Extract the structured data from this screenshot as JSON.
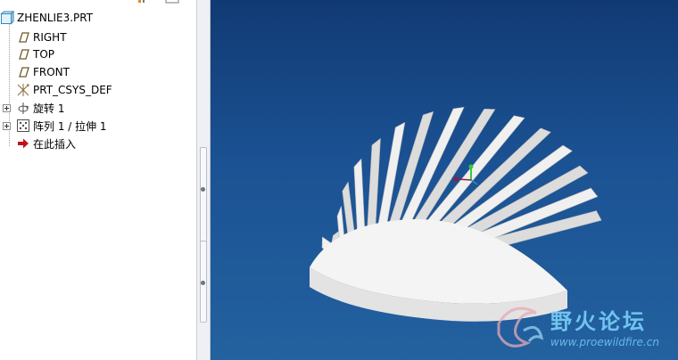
{
  "model_tree": {
    "root": "ZHENLIE3.PRT",
    "items": [
      {
        "label": "RIGHT",
        "icon": "datum-plane-icon"
      },
      {
        "label": "TOP",
        "icon": "datum-plane-icon"
      },
      {
        "label": "FRONT",
        "icon": "datum-plane-icon"
      },
      {
        "label": "PRT_CSYS_DEF",
        "icon": "coordinate-system-icon"
      },
      {
        "label": "旋转 1",
        "icon": "revolve-icon"
      },
      {
        "label": "阵列 1 / 拉伸 1",
        "icon": "pattern-icon"
      },
      {
        "label": "在此插入",
        "icon": "insert-here-arrow-icon"
      }
    ]
  },
  "watermark": {
    "title": "野火论坛",
    "url": "www.proewildfire.cn"
  },
  "colors": {
    "viewport_top": "#113a74",
    "viewport_bottom": "#23619f",
    "model_fill": "#f2f2f2",
    "insert_arrow": "#c0141c"
  }
}
